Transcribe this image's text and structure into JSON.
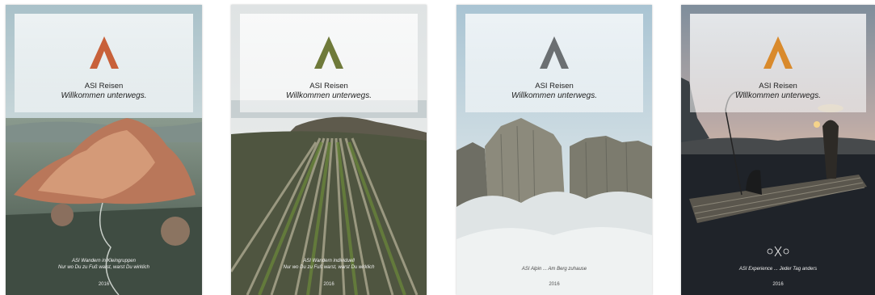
{
  "catalogs": [
    {
      "brand": "ASI Reisen",
      "slogan": "Willkommen unterwegs.",
      "tagline_1": "ASI Wandern in Kleingruppen",
      "tagline_2": "Nur wo Du zu Fuß warst, warst Du wirklich",
      "year": "2016",
      "logo_color": "#c8613a",
      "scene": "desert-granite-mountain"
    },
    {
      "brand": "ASI Reisen",
      "slogan": "Willkommen unterwegs.",
      "tagline_1": "ASI Wandern individuell",
      "tagline_2": "Nur wo Du zu Fuß warst, warst Du wirklich",
      "year": "2016",
      "logo_color": "#6f7a3a",
      "scene": "coastal-rock-strata"
    },
    {
      "brand": "ASI Reisen",
      "slogan": "Willkommen unterwegs.",
      "tagline_1": "ASI Alpin ... Am Berg zuhause",
      "year": "2016",
      "logo_color": "#6b6f72",
      "scene": "misty-cliffs"
    },
    {
      "brand": "ASI Reisen",
      "slogan": "Willkommen unterwegs.",
      "tagline_1": "ASI Experience ... Jeder Tag anders",
      "year": "2016",
      "logo_color": "#d98a2c",
      "scene": "river-fisherman-raft"
    }
  ]
}
